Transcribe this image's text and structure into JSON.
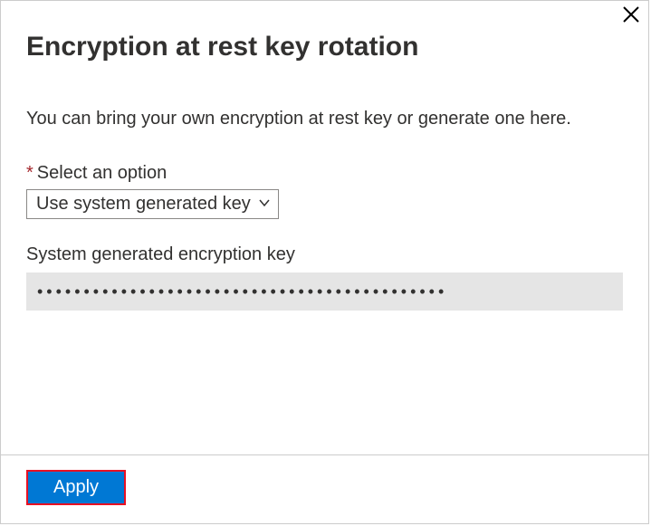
{
  "header": {
    "title": "Encryption at rest key rotation"
  },
  "body": {
    "description": "You can bring your own encryption at rest key or generate one here.",
    "option_label": "Select an option",
    "option_selected": "Use system generated key",
    "key_label": "System generated encryption key",
    "key_value": "••••••••••••••••••••••••••••••••••••••••••••"
  },
  "footer": {
    "apply_label": "Apply"
  }
}
